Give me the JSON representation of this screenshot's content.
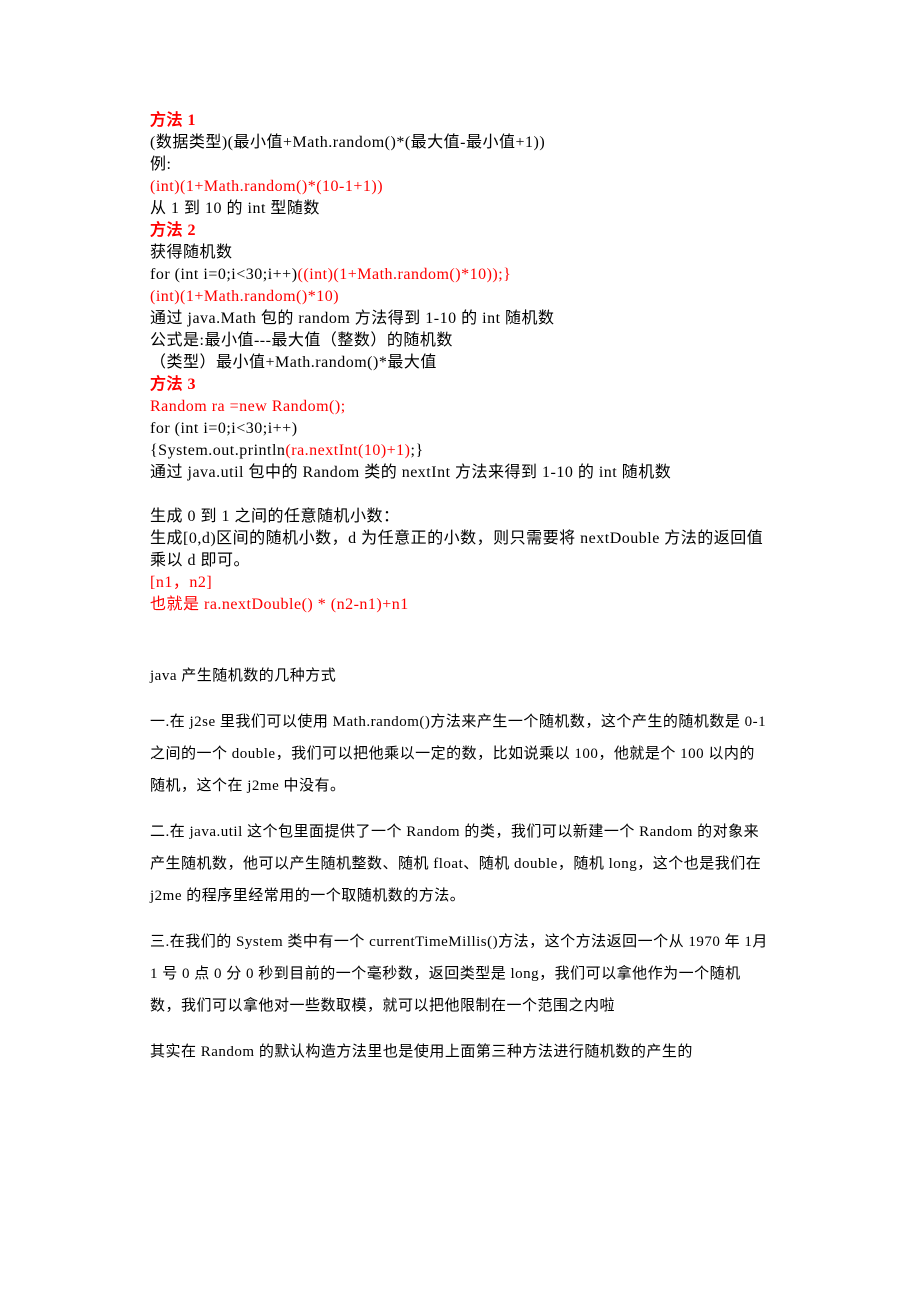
{
  "method1": {
    "title": "方法 1",
    "line1": "(数据类型)(最小值+Math.random()*(最大值-最小值+1))",
    "line2": "例:",
    "line3": "(int)(1+Math.random()*(10-1+1))",
    "line4": "从 1 到 10 的 int 型随数"
  },
  "method2": {
    "title": "方法 2",
    "line1": "获得随机数",
    "line2a": "for (int i=0;i<30;i++)",
    "line2b": "((int)(1+Math.random()*10));}",
    "line3": "(int)(1+Math.random()*10)",
    "line4": "通过 java.Math 包的 random 方法得到 1-10 的 int 随机数",
    "line5": "公式是:最小值---最大值（整数）的随机数",
    "line6": "（类型）最小值+Math.random()*最大值"
  },
  "method3": {
    "title": "方法 3",
    "line1": "Random ra =new Random();",
    "line2": "for (int i=0;i<30;i++)",
    "line3a": "{System.out.println",
    "line3b": "(ra.nextInt(10)+1)",
    "line3c": ";}",
    "line4": "通过 java.util 包中的 Random 类的 nextInt 方法来得到 1-10 的 int 随机数"
  },
  "gen": {
    "line1": "生成 0 到 1 之间的任意随机小数：",
    "line2": "生成[0,d)区间的随机小数，d 为任意正的小数，则只需要将 nextDouble 方法的返回值乘以 d 即可。",
    "line3": "[n1，n2]",
    "line4": "也就是 ra.nextDouble() * (n2-n1)+n1"
  },
  "article": {
    "title": "java 产生随机数的几种方式",
    "p1": "一.在 j2se 里我们可以使用 Math.random()方法来产生一个随机数，这个产生的随机数是 0-1之间的一个 double，我们可以把他乘以一定的数，比如说乘以 100，他就是个 100 以内的随机，这个在 j2me 中没有。",
    "p2": "二.在 java.util 这个包里面提供了一个 Random 的类，我们可以新建一个 Random 的对象来产生随机数，他可以产生随机整数、随机 float、随机 double，随机 long，这个也是我们在 j2me 的程序里经常用的一个取随机数的方法。",
    "p3": "三.在我们的 System 类中有一个 currentTimeMillis()方法，这个方法返回一个从 1970 年 1月 1 号 0 点 0 分 0 秒到目前的一个毫秒数，返回类型是 long，我们可以拿他作为一个随机数，我们可以拿他对一些数取模，就可以把他限制在一个范围之内啦",
    "p4": "其实在 Random 的默认构造方法里也是使用上面第三种方法进行随机数的产生的"
  }
}
